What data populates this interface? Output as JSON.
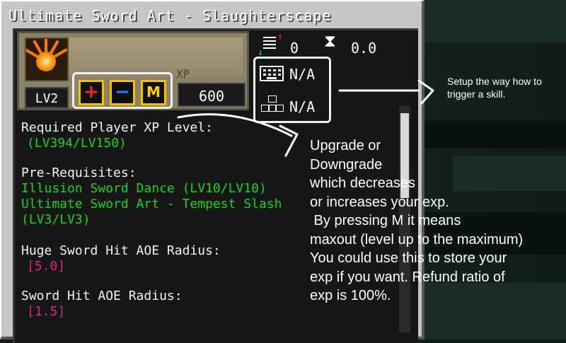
{
  "window": {
    "title": "Ultimate Sword Art - Slaughterscape"
  },
  "skill": {
    "level": "LV2",
    "xp_label": "XP",
    "xp_value": "600",
    "counter_value": "0",
    "cooldown_value": "0.0",
    "key_binding": "N/A",
    "combo_binding": "N/A"
  },
  "buttons": {
    "plus": "+",
    "minus": "−",
    "max": "M"
  },
  "info": {
    "required_label": "Required Player XP Level:",
    "required_value": "(LV394/LV150)",
    "prereq_label": "Pre-Requisites:",
    "prereq_1": "Illusion Sword Dance (LV10/LV10)",
    "prereq_2": "Ultimate Sword Art - Tempest Slash",
    "prereq_2_level": "(LV3/LV3)",
    "stat1_label": "Huge Sword Hit AOE Radius:",
    "stat1_value": "[5.0]",
    "stat2_label": "Sword Hit AOE Radius:",
    "stat2_value": "[1.5]"
  },
  "annotations": {
    "trigger_note_1": "Setup the way how to",
    "trigger_note_2": "trigger a skill.",
    "upgrade_lines": [
      "Upgrade or",
      "Downgrade",
      "which decreases",
      "or increases your exp.",
      " By pressing M it means",
      "maxout (level up to the maximum)",
      "You could use this to store your",
      "exp if you want. Refund ratio of",
      "exp is 100%."
    ]
  },
  "colors": {
    "gui_gray": "#c6c6c6",
    "level_green": "#1bd31b",
    "value_pink": "#e0208a",
    "button_border": "#f6c200"
  }
}
